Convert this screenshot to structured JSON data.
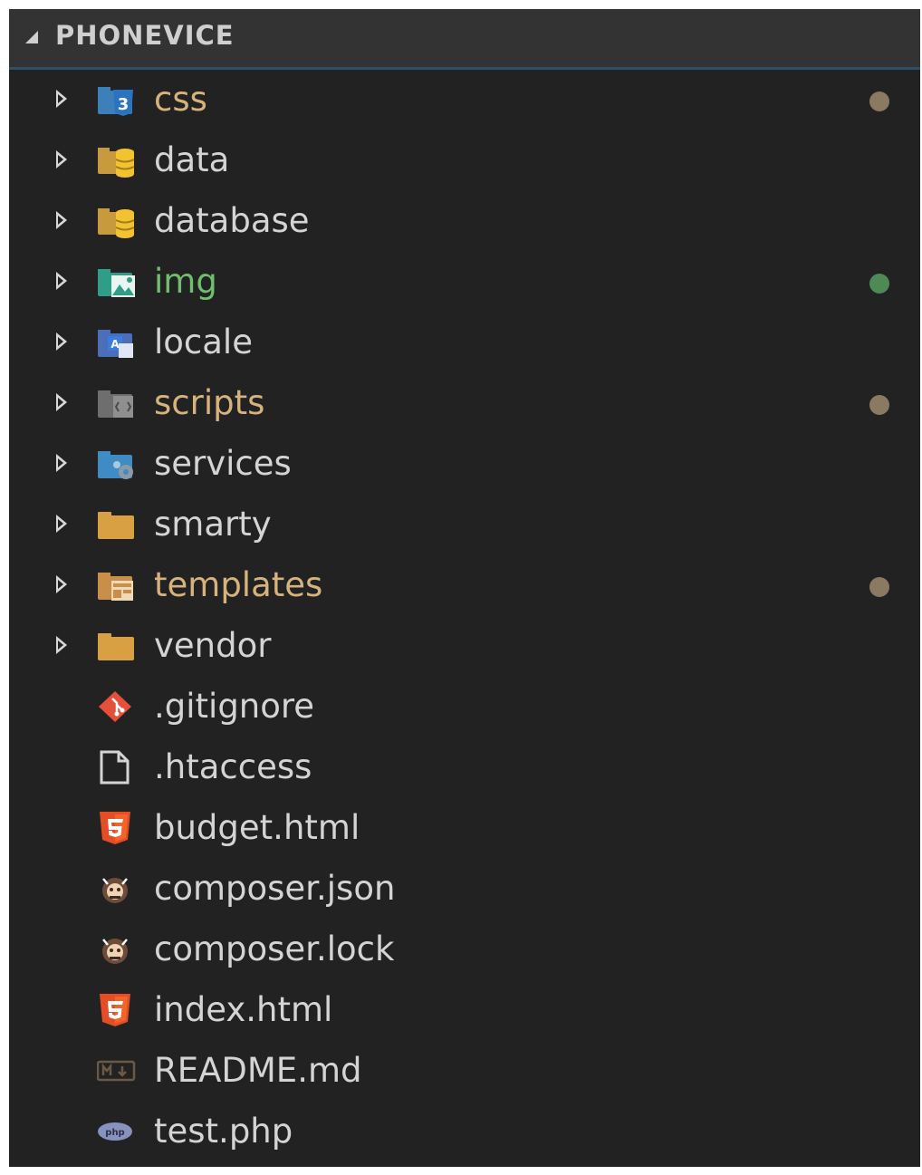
{
  "explorer": {
    "title": "PHONEVICE",
    "colors": {
      "background": "#222222",
      "header": "#333333",
      "modified_dot": "#8a7a62",
      "untracked_dot": "#4f8a56",
      "modified_text": "#d6b37a",
      "untracked_text": "#6fbf6f",
      "default_text": "#d4d4d4"
    },
    "folders": [
      {
        "label": "css",
        "icon": "css3-folder-icon",
        "status": "modified"
      },
      {
        "label": "data",
        "icon": "database-folder-icon",
        "status": ""
      },
      {
        "label": "database",
        "icon": "database-folder-icon",
        "status": ""
      },
      {
        "label": "img",
        "icon": "image-folder-icon",
        "status": "untracked"
      },
      {
        "label": "locale",
        "icon": "locale-folder-icon",
        "status": ""
      },
      {
        "label": "scripts",
        "icon": "scripts-folder-icon",
        "status": "modified"
      },
      {
        "label": "services",
        "icon": "services-folder-icon",
        "status": ""
      },
      {
        "label": "smarty",
        "icon": "folder-icon",
        "status": ""
      },
      {
        "label": "templates",
        "icon": "templates-folder-icon",
        "status": "modified"
      },
      {
        "label": "vendor",
        "icon": "folder-icon",
        "status": ""
      }
    ],
    "files": [
      {
        "label": ".gitignore",
        "icon": "git-icon"
      },
      {
        "label": ".htaccess",
        "icon": "file-icon"
      },
      {
        "label": "budget.html",
        "icon": "html5-icon"
      },
      {
        "label": "composer.json",
        "icon": "composer-icon"
      },
      {
        "label": "composer.lock",
        "icon": "composer-icon"
      },
      {
        "label": "index.html",
        "icon": "html5-icon"
      },
      {
        "label": "README.md",
        "icon": "markdown-icon"
      },
      {
        "label": "test.php",
        "icon": "php-icon"
      }
    ]
  }
}
